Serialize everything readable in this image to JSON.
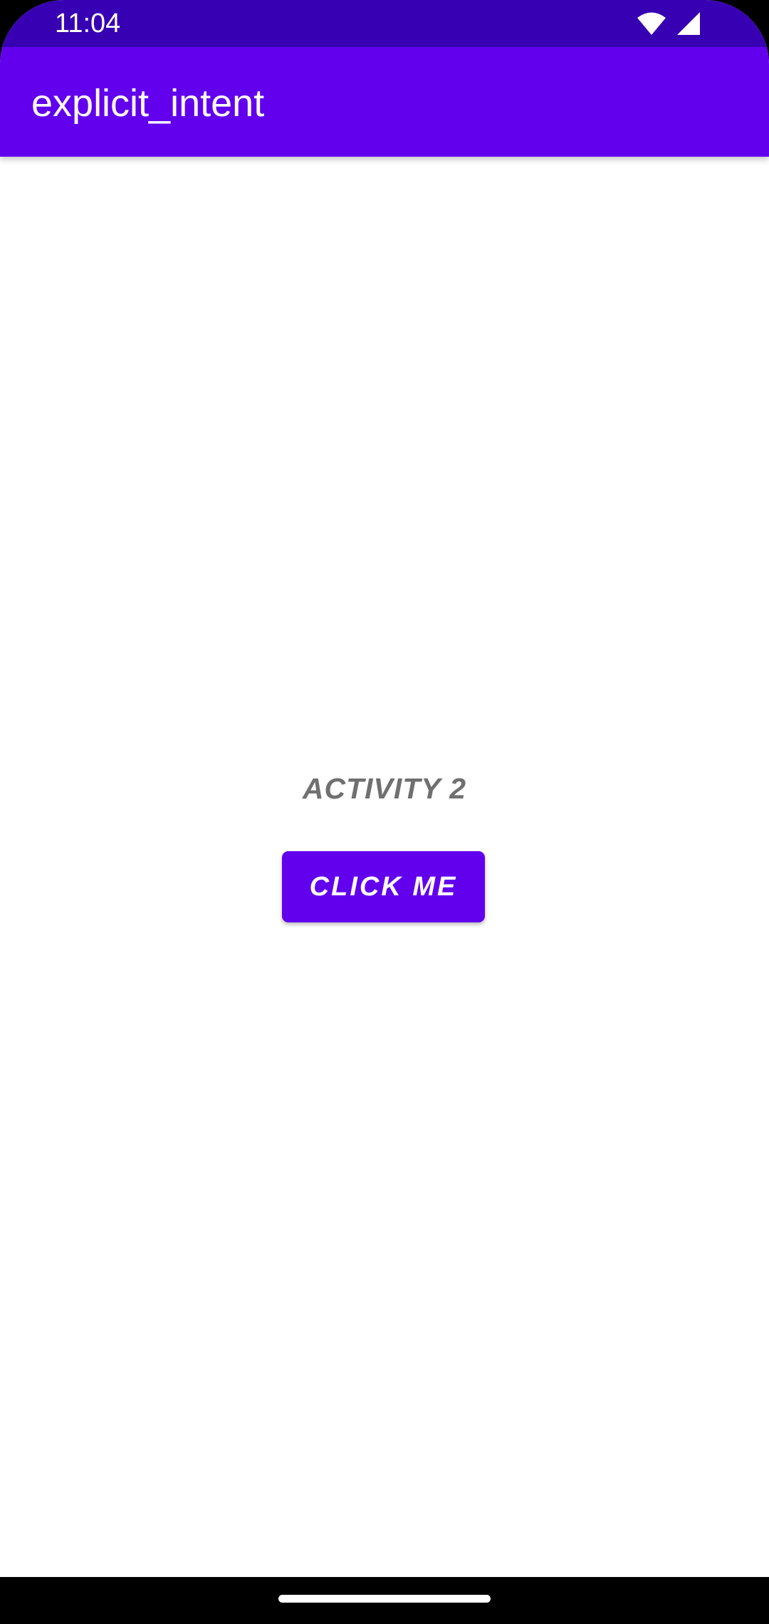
{
  "status_bar": {
    "time": "11:04",
    "icons": [
      "wifi-icon",
      "cellular-signal-icon"
    ]
  },
  "app_bar": {
    "title": "explicit_intent"
  },
  "main": {
    "label": "ACTIVITY 2",
    "button_label": "CLICK ME"
  },
  "colors": {
    "status_bar": "#3700B3",
    "primary": "#6200EE",
    "label_text": "#707070",
    "background": "#FFFFFF"
  }
}
